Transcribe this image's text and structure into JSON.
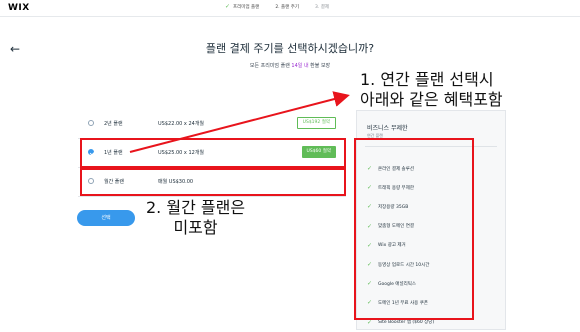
{
  "header": {
    "logo": "WIX",
    "steps": [
      {
        "check": "✓",
        "label": "프리미엄 플랜"
      },
      {
        "check": "",
        "label": "2.  플랜 주기"
      },
      {
        "check": "",
        "label": "3.  결제"
      }
    ]
  },
  "page": {
    "back_icon": "←",
    "title": "플랜 결제 주기를 선택하시겠습니까?",
    "subtitle_prefix": "모든 프리미엄 플랜",
    "subtitle_highlight": "14일 내",
    "subtitle_suffix": "환불 보장"
  },
  "plans": [
    {
      "name": "2년 플랜",
      "price": "US$22.00 x 24개월",
      "badge": "US$192 절약",
      "checked": false
    },
    {
      "name": "1년 플랜",
      "price": "US$25.00 x 12개월",
      "badge": "US$60 절약",
      "checked": true
    },
    {
      "name": "월간 플랜",
      "price": "매월 US$30.00",
      "badge": "",
      "checked": false
    }
  ],
  "select_button": "선택",
  "panel": {
    "title": "비즈니스 무제한",
    "subtitle": "연간 플랜",
    "features": [
      "온라인 결제 솔루션",
      "트래픽 용량 무제한",
      "저장용량 35GB",
      "맞춤형 도메인 연결",
      "Wix 광고 제거",
      "동영상 업로드 시간 10시간",
      "Google 애널리틱스",
      "도메인 1년 무료 사용 쿠폰",
      "Site Booster 앱 ($60 상당)"
    ]
  },
  "annotations": {
    "note1_line1": "1. 연간 플랜 선택시",
    "note1_line2": "아래와 같은 혜택포함",
    "note2_line1": "2. 월간 플랜은",
    "note2_line2": "미포함",
    "color": "#e8141c"
  },
  "colors": {
    "accent": "#3899ec",
    "success": "#60bc57",
    "highlight": "#9b2dd1"
  }
}
